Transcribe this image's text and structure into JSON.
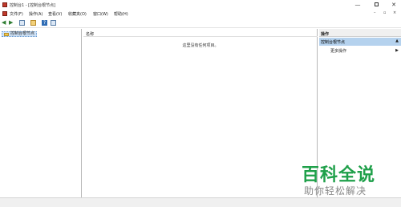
{
  "window": {
    "title": "控制台1 - [控制台根节点]",
    "controls": {
      "minimize": "—",
      "maximize": "",
      "close": "✕"
    }
  },
  "menubar": {
    "items": [
      {
        "label": "文件(F)"
      },
      {
        "label": "操作(A)"
      },
      {
        "label": "查看(V)"
      },
      {
        "label": "收藏夹(O)"
      },
      {
        "label": "窗口(W)"
      },
      {
        "label": "帮助(H)"
      }
    ],
    "mdi_controls": {
      "minimize": "–",
      "restore": "▫",
      "close": "×"
    }
  },
  "toolbar": {
    "buttons": [
      {
        "icon": "back-arrow-icon"
      },
      {
        "icon": "forward-arrow-icon"
      },
      {
        "icon": "show-hide-tree-icon"
      },
      {
        "icon": "up-folder-icon"
      },
      {
        "icon": "help-icon",
        "label": "?"
      },
      {
        "icon": "console-tree-icon"
      }
    ]
  },
  "left_pane": {
    "tree_root": "控制台根节点"
  },
  "center_pane": {
    "column_name": "名称",
    "empty_message": "这里没有任何项目。"
  },
  "right_pane": {
    "header": "操作",
    "group": "控制台根节点",
    "group_caret": "▲",
    "more_actions": "更多操作",
    "more_arrow": "▶"
  },
  "watermark": {
    "title": "百科全说",
    "subtitle": "助你轻松解决"
  },
  "colors": {
    "selection": "#cfe3f8",
    "actions_group": "#b5d2ee",
    "watermark_green": "#1fa04a"
  }
}
